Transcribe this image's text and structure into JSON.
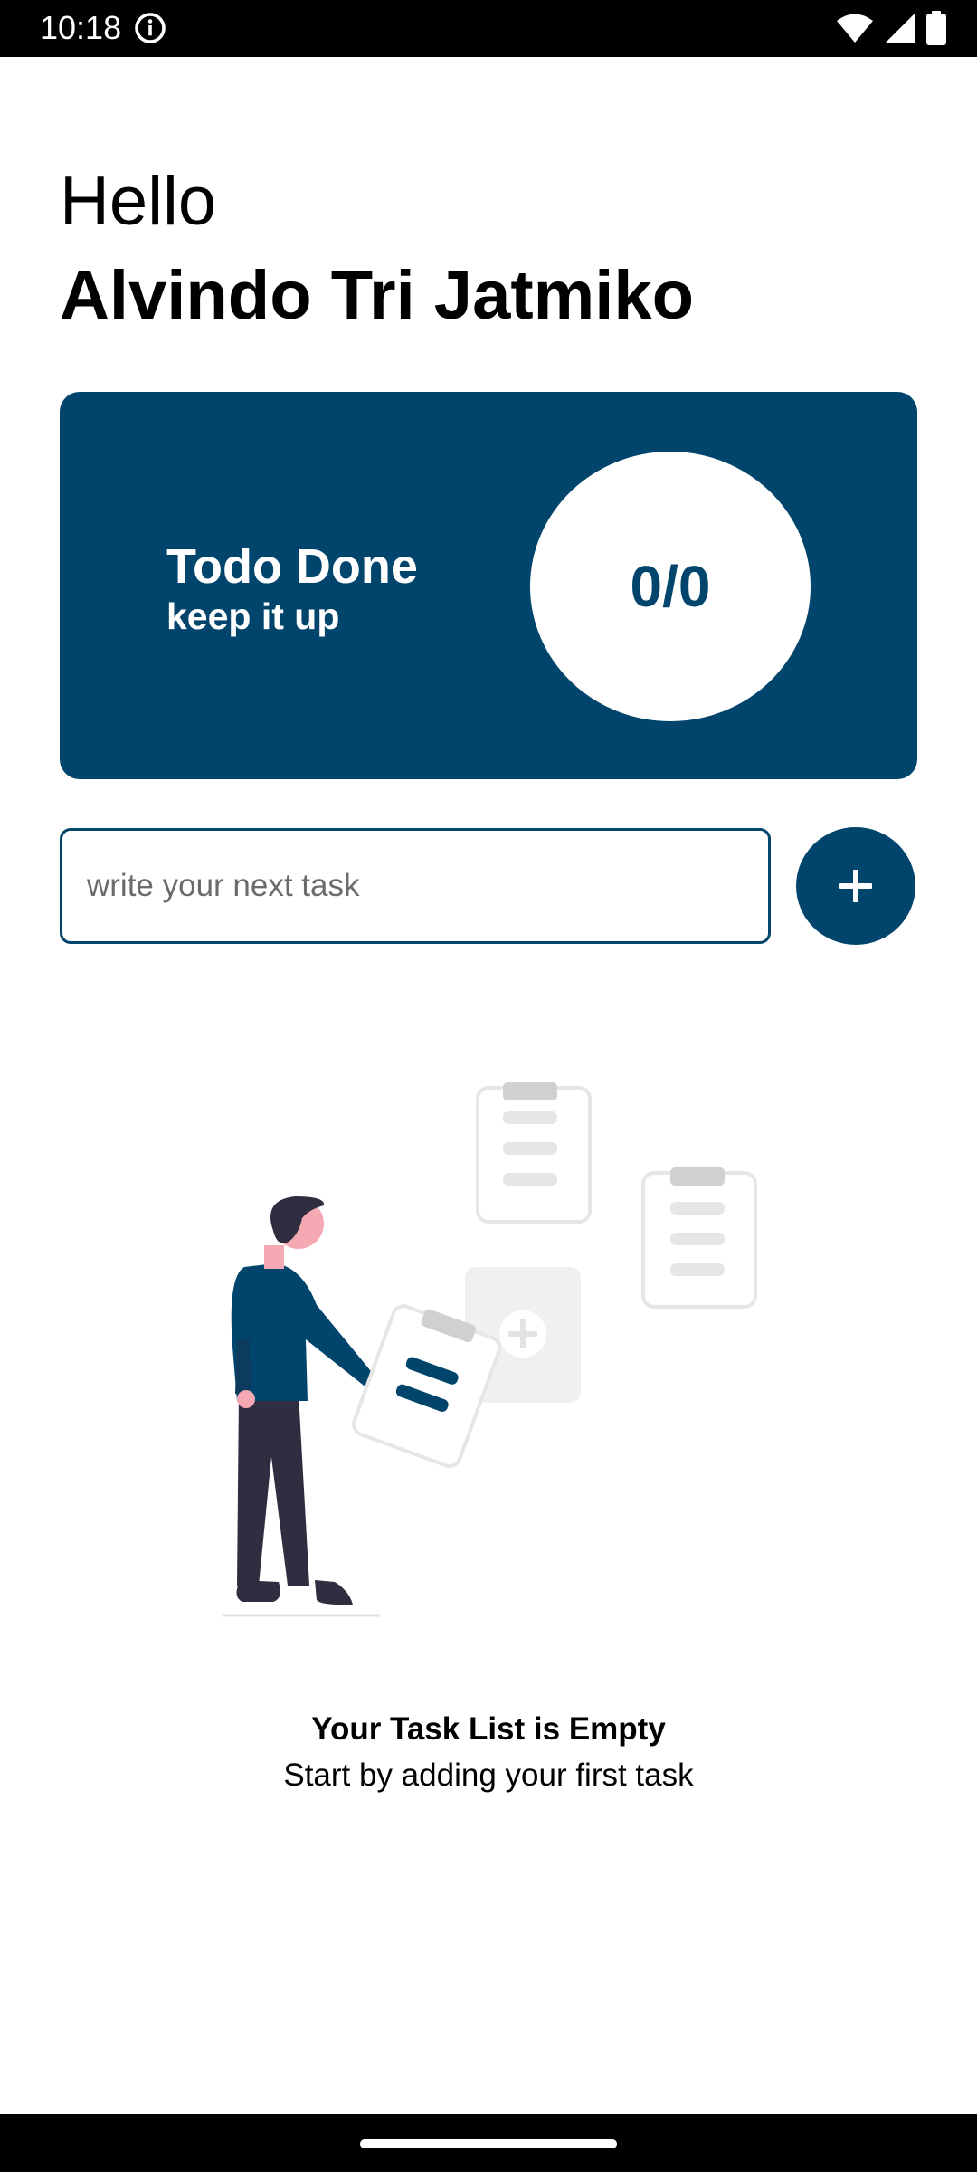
{
  "status_bar": {
    "time": "10:18",
    "icons": [
      "info-icon",
      "wifi-icon",
      "signal-icon",
      "battery-icon"
    ]
  },
  "header": {
    "greeting": "Hello",
    "user_name": "Alvindo Tri Jatmiko"
  },
  "progress_card": {
    "title": "Todo Done",
    "subtitle": "keep it up",
    "count": "0/0"
  },
  "task_input": {
    "value": "",
    "placeholder": "write your next task"
  },
  "add_button": {
    "icon": "plus-icon"
  },
  "empty_state": {
    "title": "Your Task List is Empty",
    "subtitle": "Start by adding your first task",
    "illustration": "person-with-clipboards-illustration"
  },
  "colors": {
    "primary": "#01456d",
    "background": "#ffffff",
    "text": "#000000"
  }
}
